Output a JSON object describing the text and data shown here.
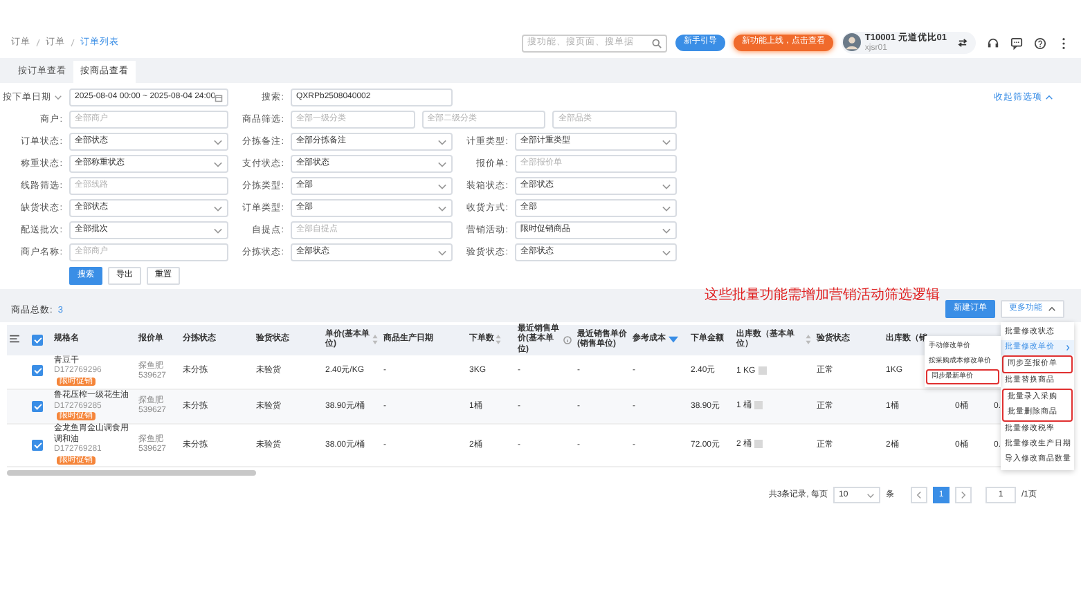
{
  "breadcrumb": [
    {
      "label": "订单",
      "current": false
    },
    {
      "label": "订单",
      "current": false
    },
    {
      "label": "订单列表",
      "current": true
    }
  ],
  "topbar": {
    "search": {
      "placeholder": "搜功能、搜页面、搜单据"
    },
    "guide_button": "新手引导",
    "news_button": "新功能上线，点击查看",
    "user": {
      "name": "T10001 元道优比01",
      "account": "xjsr01"
    }
  },
  "view_tabs": [
    {
      "label": "按订单查看",
      "selected": false
    },
    {
      "label": "按商品查看",
      "selected": true
    }
  ],
  "filters": {
    "collapse_link": "收起筛选项",
    "rows": [
      [
        {
          "kind": "date",
          "label": "按下单日期",
          "value": "2025-08-04 00:00 ~ 2025-08-04 24:00"
        },
        {
          "kind": "input",
          "label": "搜索:",
          "value": "QXRPb2508040002"
        }
      ],
      [
        {
          "kind": "input",
          "label": "商户:",
          "placeholder": "全部商户"
        },
        {
          "kind": "multi",
          "label": "商品筛选:",
          "inputs": [
            {
              "placeholder": "全部一级分类"
            },
            {
              "placeholder": "全部二级分类"
            },
            {
              "placeholder": "全部品类"
            }
          ]
        }
      ],
      [
        {
          "kind": "select",
          "label": "订单状态:",
          "value": "全部状态"
        },
        {
          "kind": "select",
          "label": "分拣备注:",
          "value": "全部分拣备注"
        },
        {
          "kind": "select",
          "label": "计重类型:",
          "value": "全部计重类型"
        }
      ],
      [
        {
          "kind": "select",
          "label": "称重状态:",
          "value": "全部称重状态"
        },
        {
          "kind": "select",
          "label": "支付状态:",
          "value": "全部状态"
        },
        {
          "kind": "input",
          "label": "报价单:",
          "placeholder": "全部报价单"
        }
      ],
      [
        {
          "kind": "input",
          "label": "线路筛选:",
          "placeholder": "全部线路"
        },
        {
          "kind": "select",
          "label": "分拣类型:",
          "value": "全部"
        },
        {
          "kind": "select",
          "label": "装箱状态:",
          "value": "全部状态"
        }
      ],
      [
        {
          "kind": "select",
          "label": "缺货状态:",
          "value": "全部状态"
        },
        {
          "kind": "select",
          "label": "订单类型:",
          "value": "全部"
        },
        {
          "kind": "select",
          "label": "收货方式:",
          "value": "全部"
        }
      ],
      [
        {
          "kind": "select",
          "label": "配送批次:",
          "value": "全部批次"
        },
        {
          "kind": "input",
          "label": "自提点:",
          "placeholder": "全部自提点"
        },
        {
          "kind": "select",
          "label": "营销活动:",
          "value": "限时促销商品"
        }
      ],
      [
        {
          "kind": "input",
          "label": "商户名称:",
          "placeholder": "全部商户"
        },
        {
          "kind": "select",
          "label": "分拣状态:",
          "value": "全部状态"
        },
        {
          "kind": "select",
          "label": "验货状态:",
          "value": "全部状态"
        }
      ]
    ],
    "actions": [
      {
        "label": "搜索",
        "primary": true
      },
      {
        "label": "导出",
        "primary": false
      },
      {
        "label": "重置",
        "primary": false
      }
    ]
  },
  "summary": {
    "label": "商品总数:",
    "count": "3",
    "annotation": "这些批量功能需增加营销活动筛选逻辑",
    "buttons": [
      {
        "label": "新建订单",
        "primary": true,
        "expanded": false
      },
      {
        "label": "更多功能",
        "primary": false,
        "expanded": true
      }
    ]
  },
  "table": {
    "all_selected": true,
    "columns": [
      {
        "label": "规格名"
      },
      {
        "label": "报价单"
      },
      {
        "label": "分拣状态"
      },
      {
        "label": "验货状态"
      },
      {
        "label": "单价(基本单位)",
        "sortable": true
      },
      {
        "label": "商品生产日期"
      },
      {
        "label": "下单数",
        "sortable": true
      },
      {
        "label": "最近销售单价(基本单位)",
        "info": true
      },
      {
        "label": "最近销售单价(销售单位)"
      },
      {
        "label": "参考成本",
        "filter": true
      },
      {
        "label": "下单金额"
      },
      {
        "label": "出库数（基本单位）",
        "sortable": true,
        "kind": "qty"
      },
      {
        "label": "验货状态"
      },
      {
        "label": "出库数（销"
      },
      {},
      {}
    ],
    "rows": [
      {
        "selected": true,
        "cells": [
          {
            "name": "青豆干",
            "code": "D172769296",
            "badge": "限时促销"
          },
          "探鱼肥539627",
          "未分拣",
          "未验货",
          "2.40元/KG",
          "-",
          "3KG",
          "-",
          "-",
          "-",
          "2.40元",
          "1 KG",
          "正常",
          "1KG",
          null,
          null
        ]
      },
      {
        "selected": true,
        "cells": [
          {
            "name": "鲁花压榨一级花生油",
            "code": "D172769285",
            "badge": "限时促销"
          },
          "探鱼肥539627",
          "未分拣",
          "未验货",
          "38.90元/桶",
          "-",
          "1桶",
          "-",
          "-",
          "-",
          "38.90元",
          "1 桶",
          "正常",
          "1桶",
          "0桶",
          "0."
        ]
      },
      {
        "selected": true,
        "cells": [
          {
            "name": "金龙鱼胃金山调食用调和油",
            "code": "D172769281",
            "badge": "限时促销"
          },
          "探鱼肥539627",
          "未分拣",
          "未验货",
          "38.00元/桶",
          "-",
          "2桶",
          "-",
          "-",
          "-",
          "72.00元",
          "2 桶",
          "正常",
          "2桶",
          "0桶",
          "0."
        ]
      }
    ]
  },
  "more_menu": {
    "sections": [
      {
        "outlined": false,
        "items": [
          {
            "label": "批量修改状态",
            "selected": false,
            "submenu": false
          },
          {
            "label": "批量修改单价",
            "selected": true,
            "submenu": true
          }
        ]
      },
      {
        "outlined": true,
        "items": [
          {
            "label": "同步至报价单",
            "selected": false,
            "submenu": false
          }
        ]
      },
      {
        "outlined": false,
        "items": [
          {
            "label": "批量替换商品",
            "selected": false,
            "submenu": false
          }
        ]
      },
      {
        "outlined": true,
        "items": [
          {
            "label": "批量录入采购",
            "selected": false,
            "submenu": false
          },
          {
            "label": "批量删除商品",
            "selected": false,
            "submenu": false
          }
        ]
      },
      {
        "outlined": false,
        "items": [
          {
            "label": "批量修改税率",
            "selected": false,
            "submenu": false
          },
          {
            "label": "批量修改生产日期",
            "selected": false,
            "submenu": false
          },
          {
            "label": "导入修改商品数量",
            "selected": false,
            "submenu": false
          }
        ]
      }
    ]
  },
  "price_submenu": [
    {
      "label": "手动修改单价",
      "outlined": false
    },
    {
      "label": "按采购成本修改单价",
      "outlined": false
    },
    {
      "label": "同步最新单价",
      "outlined": true
    }
  ],
  "pagination": {
    "total": "共3条记录, 每页",
    "page_size": "10",
    "unit": "条",
    "pages": [
      {
        "label": "1",
        "selected": true
      }
    ],
    "jump": "1",
    "total_pages": "/1页"
  }
}
